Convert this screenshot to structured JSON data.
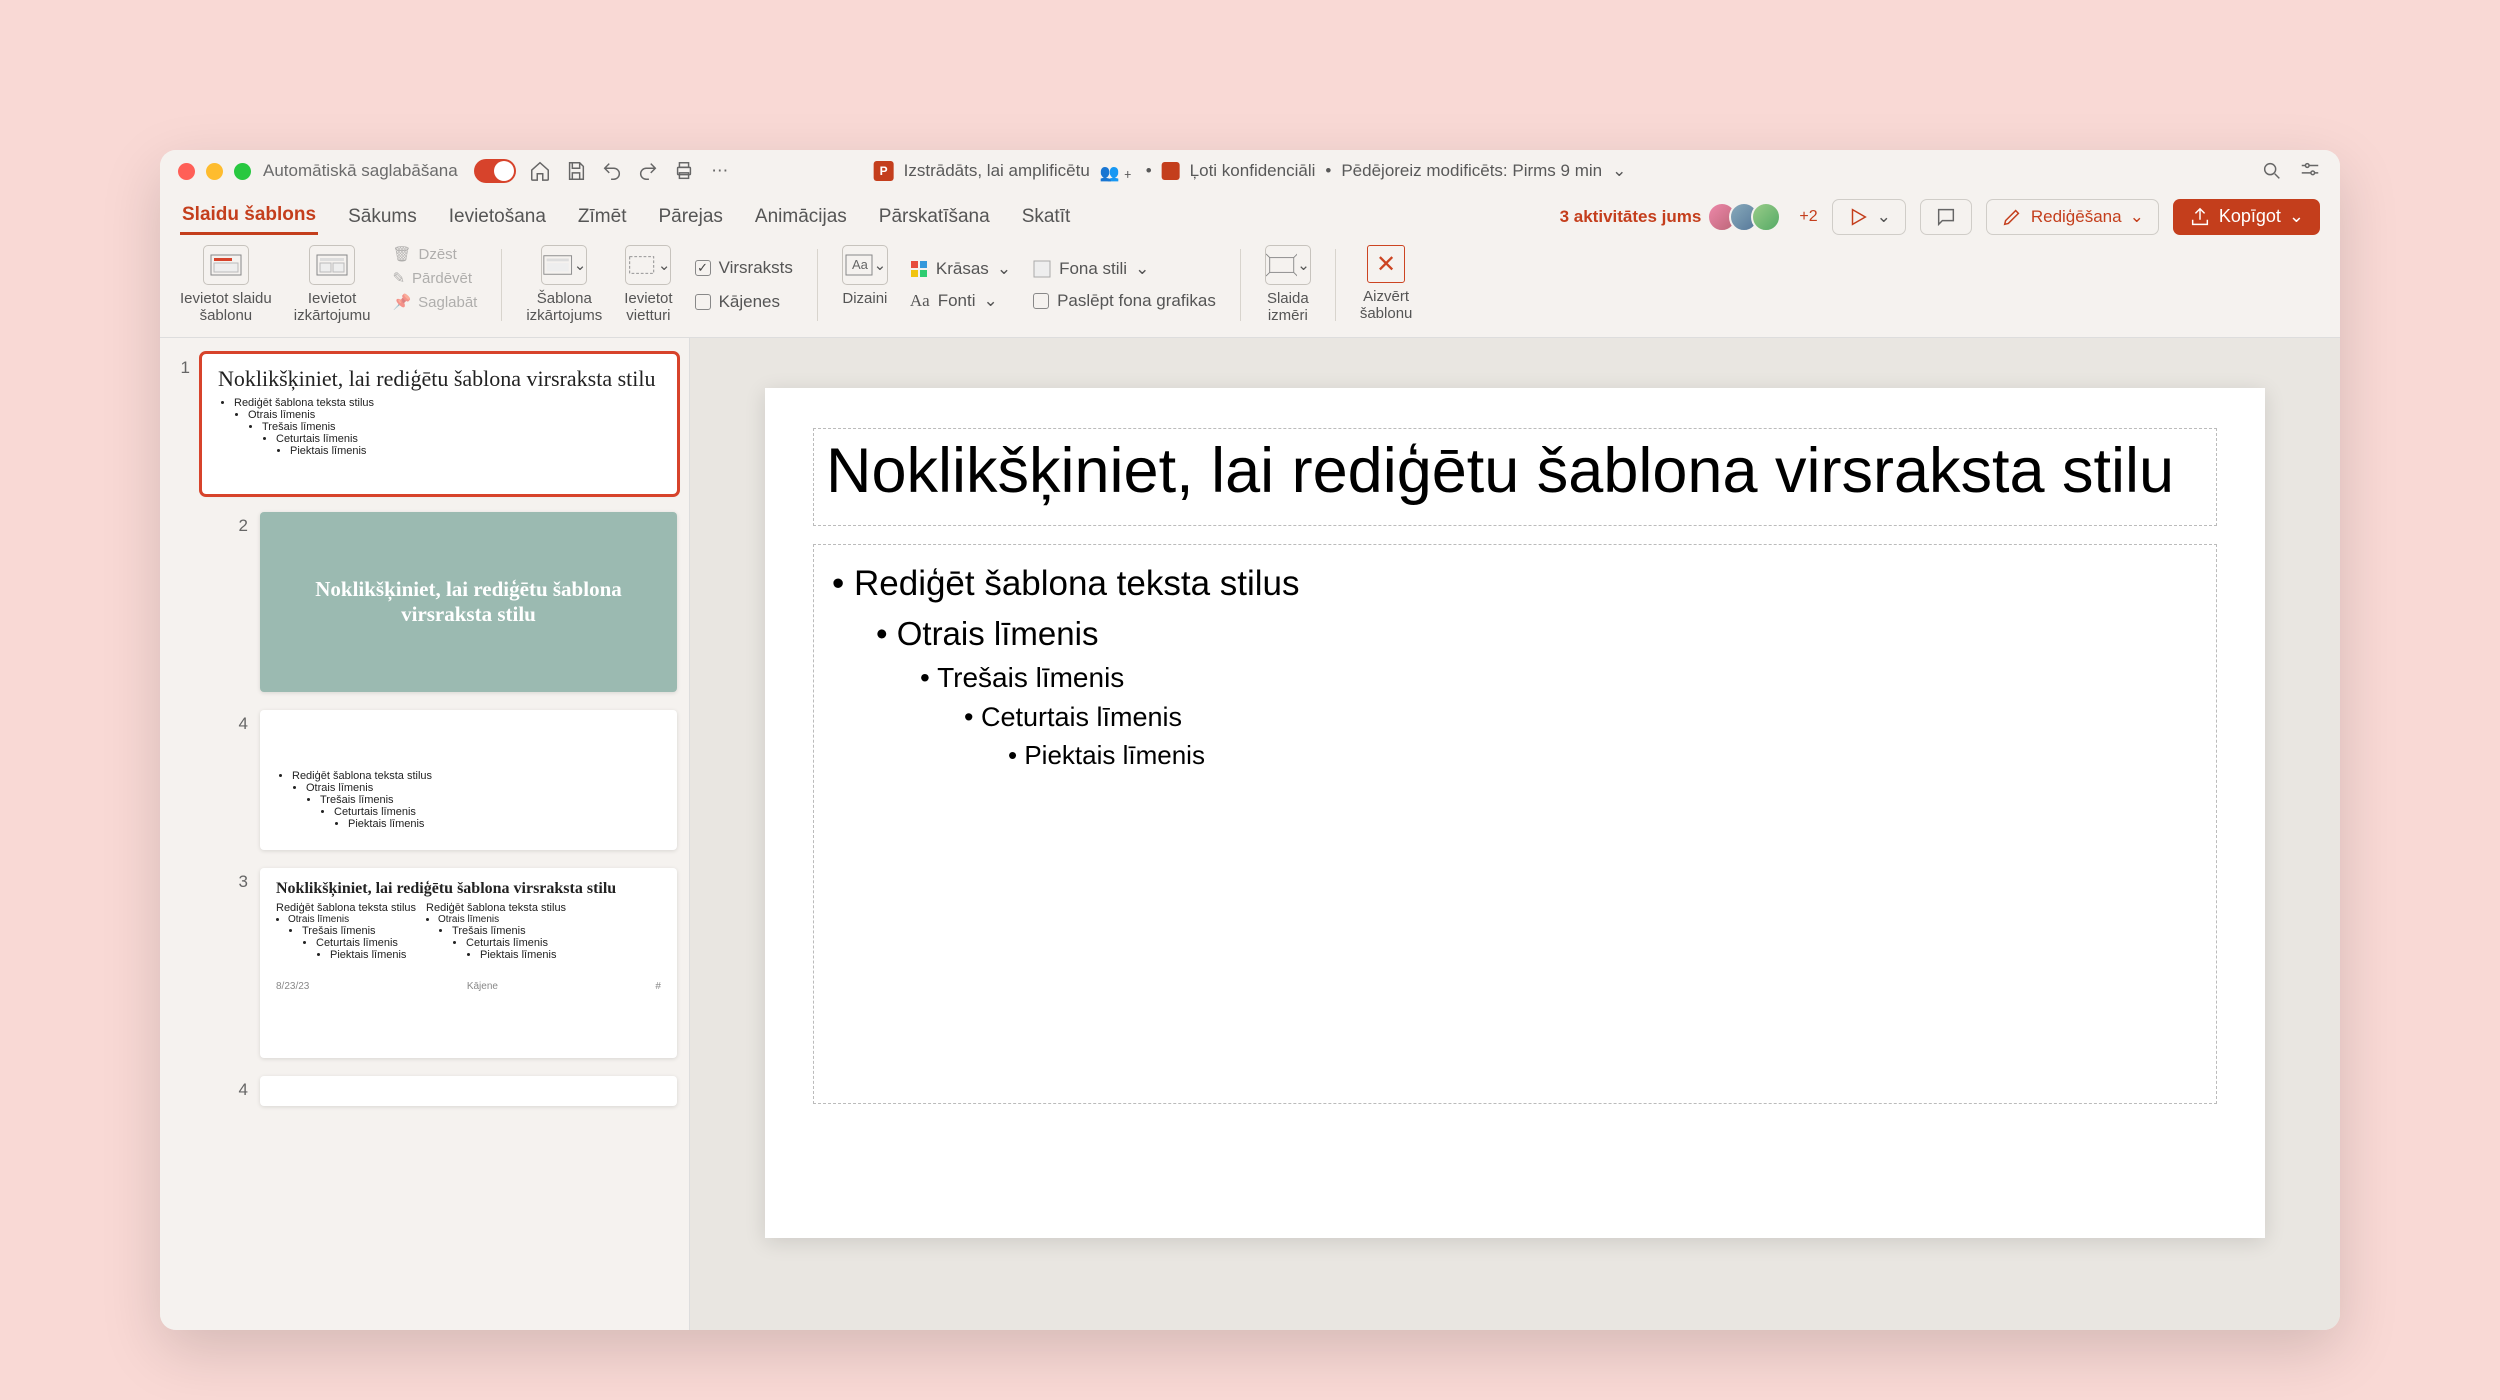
{
  "titlebar": {
    "autosave_label": "Automātiskā saglabāšana",
    "doc_title": "Izstrādāts, lai amplificētu",
    "sensitivity": "Ļoti konfidenciāli",
    "last_modified": "Pēdējoreiz modificēts: Pirms 9 min"
  },
  "tabs": {
    "items": [
      {
        "label": "Slaidu šablons",
        "active": true
      },
      {
        "label": "Sākums",
        "active": false
      },
      {
        "label": "Ievietošana",
        "active": false
      },
      {
        "label": "Zīmēt",
        "active": false
      },
      {
        "label": "Pārejas",
        "active": false
      },
      {
        "label": "Animācijas",
        "active": false
      },
      {
        "label": "Pārskatīšana",
        "active": false
      },
      {
        "label": "Skatīt",
        "active": false
      }
    ],
    "activity_label": "3 aktivitātes jums",
    "plus_count": "+2",
    "edit_label": "Rediģēšana",
    "share_label": "Kopīgot"
  },
  "ribbon": {
    "insert_master": "Ievietot slaidu\nšablonu",
    "insert_layout": "Ievietot\nizkārtojumu",
    "delete": "Dzēst",
    "rename": "Pārdēvēt",
    "preserve": "Saglabāt",
    "master_layout": "Šablona\nizkārtojums",
    "insert_placeholder": "Ievietot\nvietturi",
    "title_cb": "Virsraksts",
    "footers_cb": "Kājenes",
    "designs": "Dizaini",
    "colors": "Krāsas",
    "fonts": "Fonti",
    "bg_styles": "Fona stili",
    "hide_bg": "Paslēpt fona grafikas",
    "slide_size": "Slaida\nizmēri",
    "close_master": "Aizvērt\nšablonu"
  },
  "thumbnails": [
    {
      "num": "1",
      "type": "master",
      "title": "Noklikšķiniet, lai rediģētu šablona virsraksta stilu",
      "l1": "Rediģēt šablona teksta stilus",
      "l2": "Otrais līmenis",
      "l3": "Trešais līmenis",
      "l4": "Ceturtais līmenis",
      "l5": "Piektais līmenis"
    },
    {
      "num": "2",
      "type": "teal",
      "title": "Noklikšķiniet, lai rediģētu šablona virsraksta stilu"
    },
    {
      "num": "4",
      "type": "half",
      "l1": "Rediģēt šablona teksta stilus",
      "l2": "Otrais līmenis",
      "l3": "Trešais līmenis",
      "l4": "Ceturtais līmenis",
      "l5": "Piektais līmenis"
    },
    {
      "num": "3",
      "type": "two-col",
      "title": "Noklikšķiniet, lai rediģētu šablona virsraksta stilu",
      "col_head": "Rediģēt šablona teksta stilus",
      "l2": "Otrais līmenis",
      "l3": "Trešais līmenis",
      "l4": "Ceturtais līmenis",
      "l5": "Piektais līmenis",
      "date": "8/23/23",
      "footer": "Kājene"
    },
    {
      "num": "4",
      "type": "partial"
    }
  ],
  "slide": {
    "title": "Noklikšķiniet, lai rediģētu šablona virsraksta stilu",
    "l1": "Rediģēt šablona teksta stilus",
    "l2": "Otrais līmenis",
    "l3": "Trešais līmenis",
    "l4": "Ceturtais līmenis",
    "l5": "Piektais līmenis"
  }
}
